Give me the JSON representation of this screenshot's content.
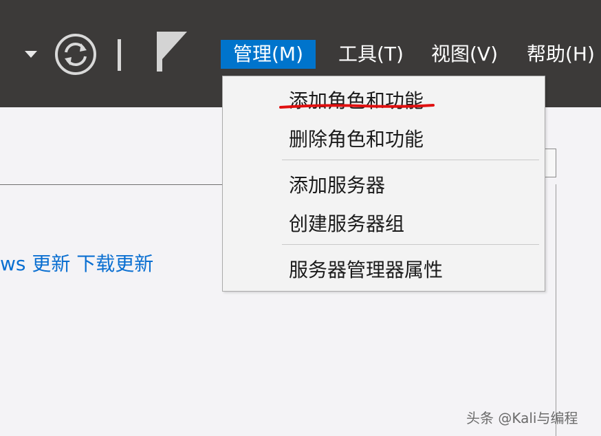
{
  "menubar": {
    "items": [
      "管理(M)",
      "工具(T)",
      "视图(V)",
      "帮助(H)"
    ]
  },
  "manage_menu": {
    "items": [
      "添加角色和功能",
      "删除角色和功能",
      "添加服务器",
      "创建服务器组",
      "服务器管理器属性"
    ]
  },
  "content": {
    "link_partial": "ws 更新",
    "link_download": "下载更新"
  },
  "watermark": "头条 @Kali与编程",
  "colors": {
    "topbar": "#3c3a39",
    "menu_highlight": "#0074cc",
    "link": "#0a6fd1",
    "annotation": "#e01010"
  }
}
